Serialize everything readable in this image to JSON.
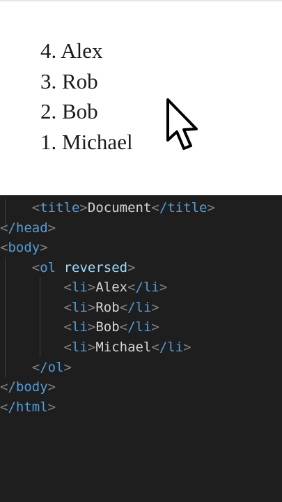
{
  "preview": {
    "list": [
      {
        "number": "4.",
        "name": "Alex"
      },
      {
        "number": "3.",
        "name": "Rob"
      },
      {
        "number": "2.",
        "name": "Bob"
      },
      {
        "number": "1.",
        "name": "Michael"
      }
    ]
  },
  "code": {
    "partial_char": ">",
    "title_open": "title",
    "title_text": "Document",
    "title_close": "/title",
    "head_close": "/head",
    "body_open": "body",
    "ol_open": "ol",
    "ol_attr": "reversed",
    "li_tag": "li",
    "li_close": "/li",
    "items": [
      "Alex",
      "Rob",
      "Bob",
      "Michael"
    ],
    "ol_close": "/ol",
    "body_close": "/body",
    "html_close": "/html"
  },
  "colors": {
    "editor_bg": "#1e1e1e",
    "tag_name": "#569cd6",
    "bracket": "#808080",
    "attribute": "#9cdcfe",
    "text": "#d4d4d4",
    "preview_bg": "#ffffff"
  },
  "icons": {
    "cursor": "arrow-pointer-icon"
  }
}
